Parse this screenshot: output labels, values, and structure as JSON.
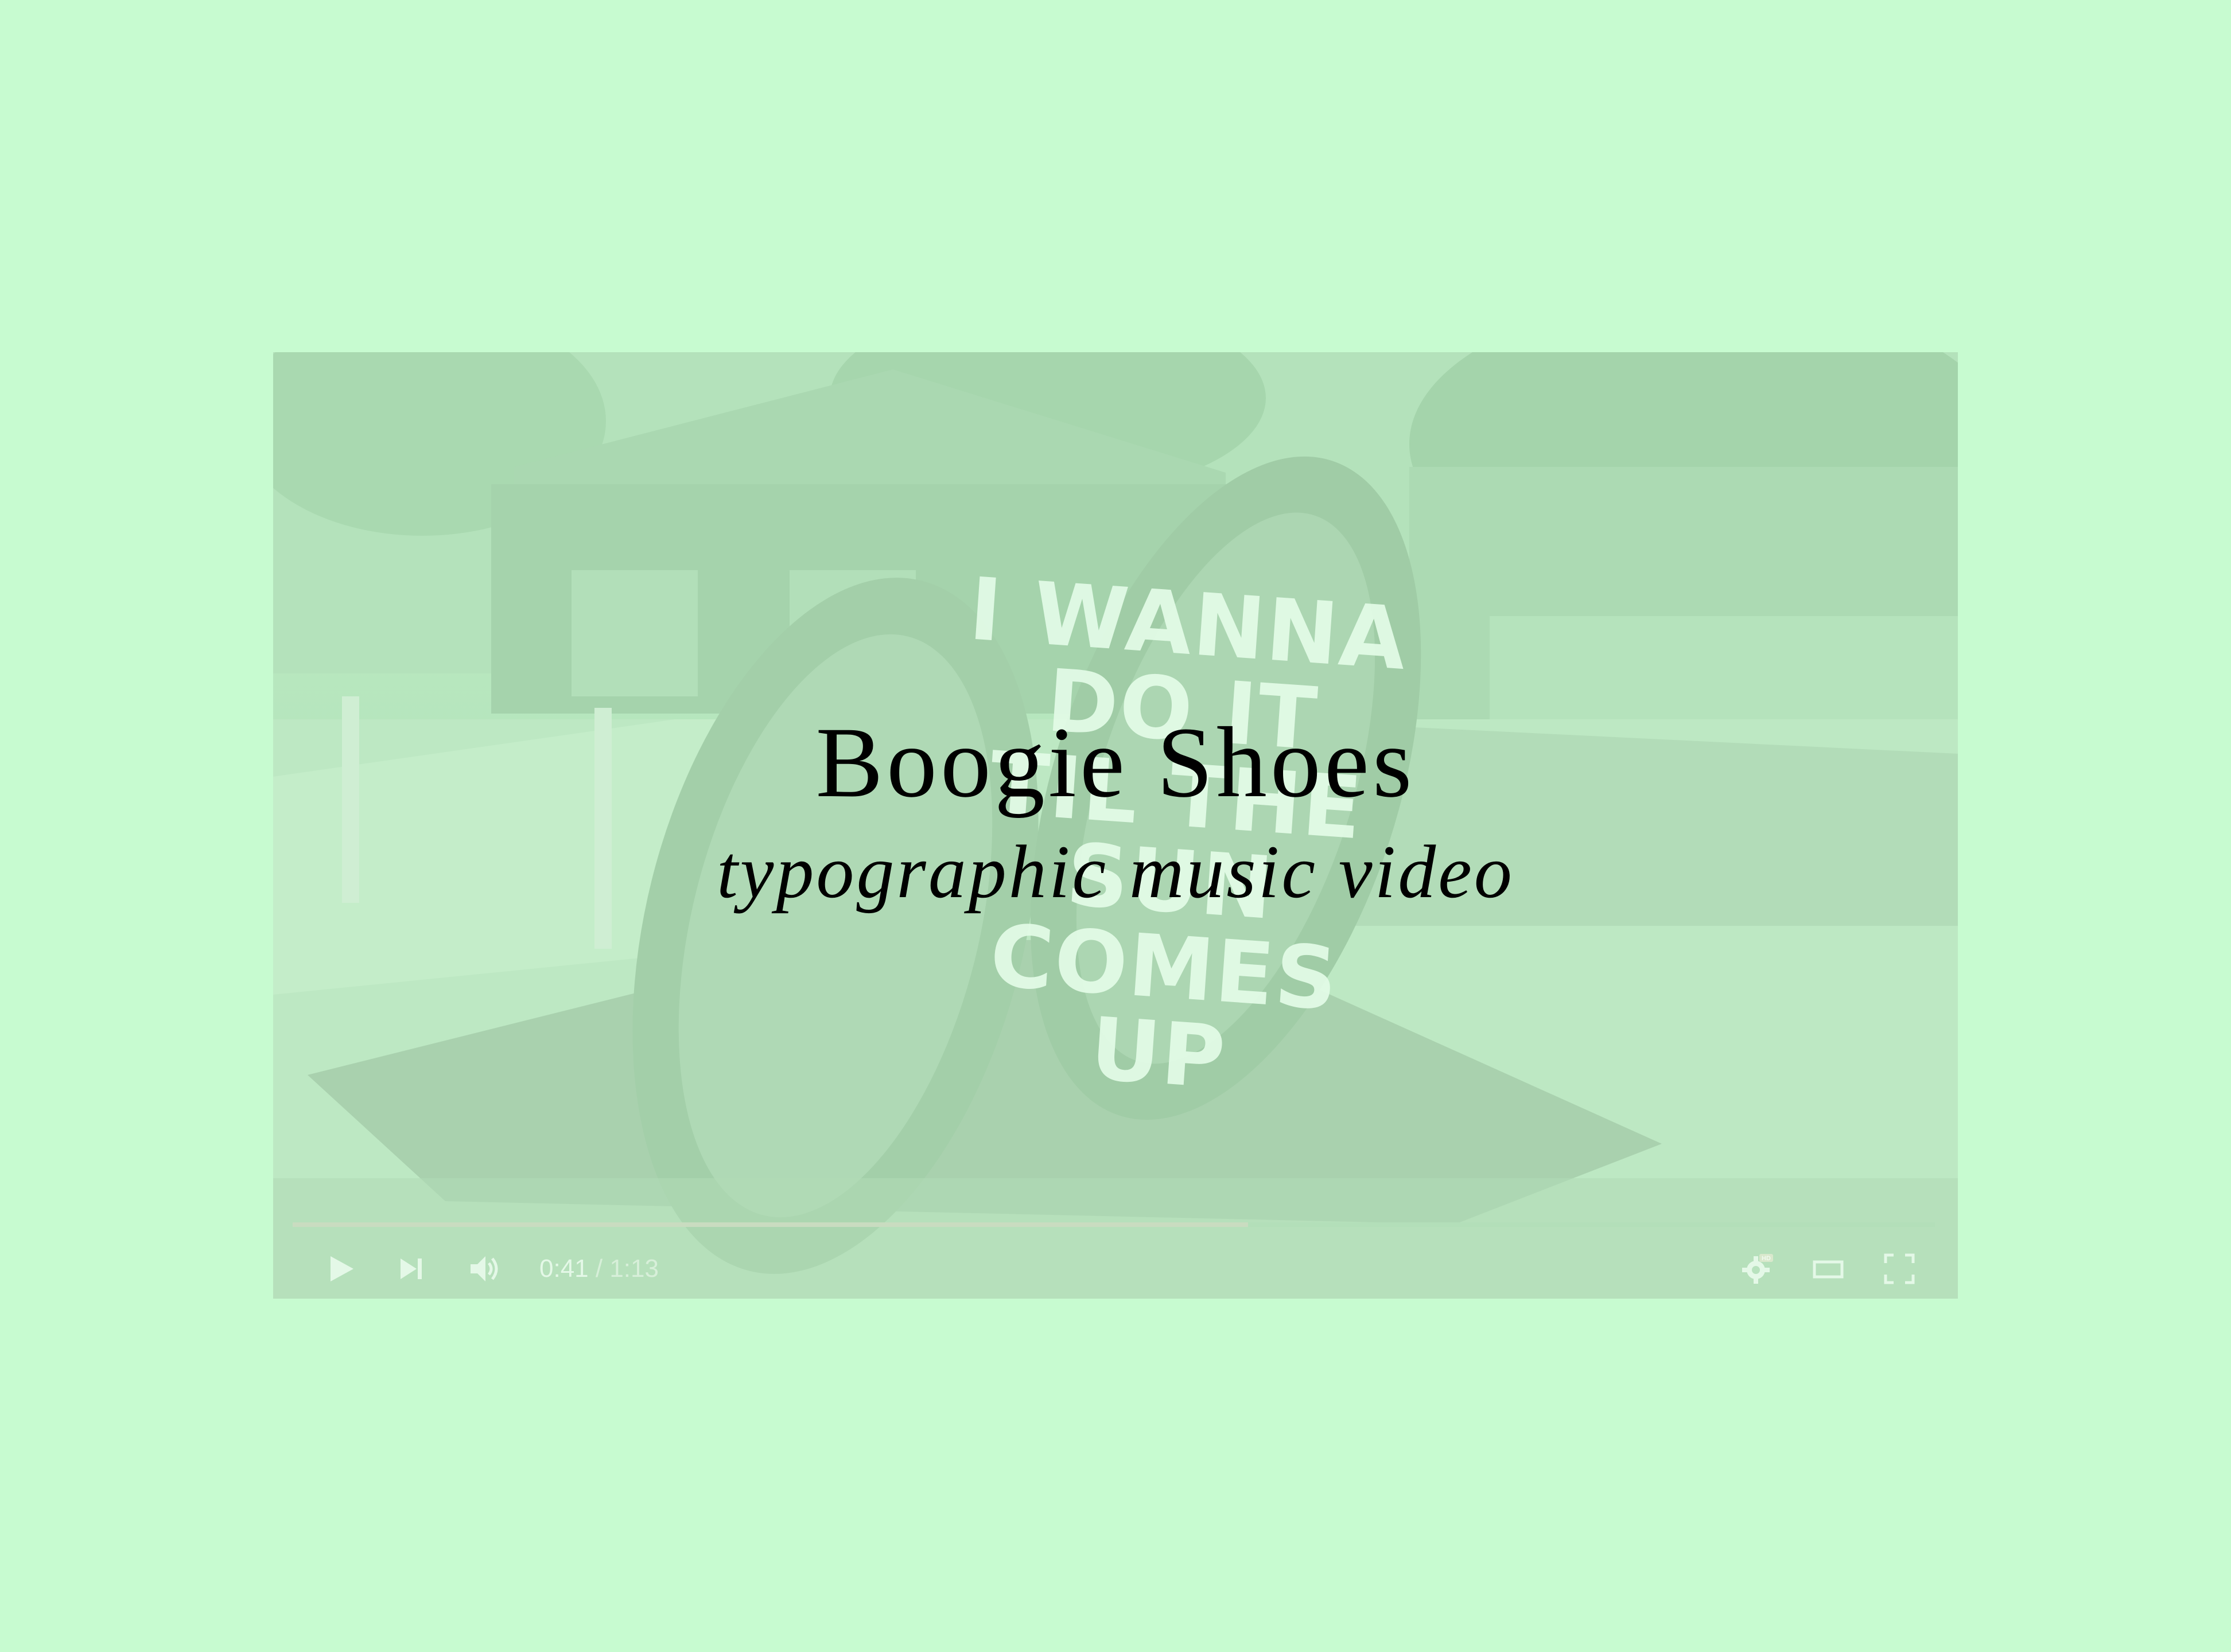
{
  "page": {
    "background_color": "#c7fbd0",
    "title": "Boogie Shoes",
    "subtitle": "typographic music video"
  },
  "video": {
    "lyric_lines": [
      "I WANNA",
      "DO IT",
      "TIL THE",
      "SUN",
      "COMES",
      "UP"
    ],
    "progress_fraction": 0.5818,
    "controls": {
      "current_time": "0:41",
      "separator": " / ",
      "duration": "1:13",
      "play_icon": "play-icon",
      "next_icon": "next-track-icon",
      "volume_icon": "volume-icon",
      "settings_icon": "settings-gear-icon",
      "settings_badge": "HD",
      "theater_icon": "theater-mode-icon",
      "fullscreen_icon": "fullscreen-icon"
    }
  }
}
